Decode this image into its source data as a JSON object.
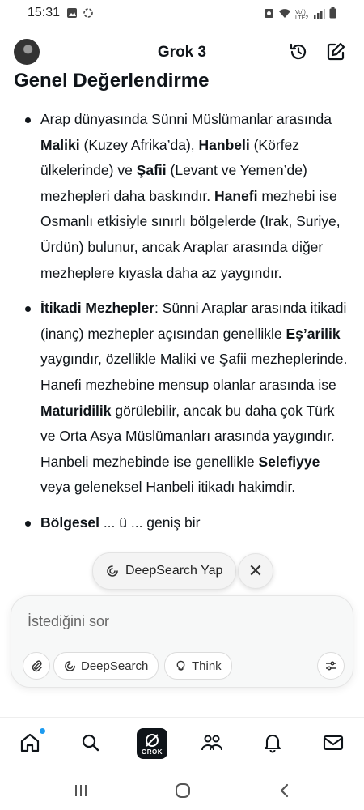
{
  "status_bar": {
    "time": "15:31",
    "left_icons": [
      "image-icon",
      "sync-icon"
    ],
    "right_icons": [
      "alarm-icon",
      "wifi-icon",
      "volte-icon",
      "signal-icon",
      "battery-icon"
    ],
    "network_label": "Vo))\nLTE2"
  },
  "header": {
    "title": "Grok 3",
    "avatar_icon": "avatar-icon",
    "history_icon": "history-icon",
    "edit_icon": "edit-icon"
  },
  "content": {
    "heading": "Genel Değerlendirme",
    "bullets": [
      {
        "segments": [
          {
            "text": "Arap dünyasında Sünni Müslümanlar arasında ",
            "bold": false
          },
          {
            "text": "Maliki",
            "bold": true
          },
          {
            "text": " (Kuzey Afrika’da), ",
            "bold": false
          },
          {
            "text": "Hanbeli",
            "bold": true
          },
          {
            "text": " (Körfez ülkelerinde) ve ",
            "bold": false
          },
          {
            "text": "Şafii",
            "bold": true
          },
          {
            "text": " (Levant ve Yemen’de) mezhepleri daha baskındır. ",
            "bold": false
          },
          {
            "text": "Hanefi",
            "bold": true
          },
          {
            "text": " mezhebi ise Osmanlı etkisiyle sınırlı bölgelerde (Irak, Suriye, Ürdün) bulunur, ancak Araplar arasında diğer mezheplere kıyasla daha az yaygındır.",
            "bold": false
          }
        ]
      },
      {
        "segments": [
          {
            "text": "İtikadi Mezhepler",
            "bold": true
          },
          {
            "text": ": Sünni Araplar arasında itikadi (inanç) mezhepler açısından genellikle ",
            "bold": false
          },
          {
            "text": "Eş’arilik",
            "bold": true
          },
          {
            "text": " yaygındır, özellikle Maliki ve Şafii mezheplerinde. Hanefi mezhebine mensup olanlar arasında ise ",
            "bold": false
          },
          {
            "text": "Maturidilik",
            "bold": true
          },
          {
            "text": " görülebilir, ancak bu daha çok Türk ve Orta Asya Müslümanları arasında yaygındır. Hanbeli mezhebinde ise genellikle ",
            "bold": false
          },
          {
            "text": "Selefiyye",
            "bold": true
          },
          {
            "text": " veya geleneksel Hanbeli itikadı hakimdir.",
            "bold": false
          }
        ]
      },
      {
        "segments": [
          {
            "text": "Bölgesel",
            "bold": true
          },
          {
            "text": " ... ü ... geniş bir",
            "bold": false
          }
        ]
      }
    ]
  },
  "deepsearch_suggestion": {
    "label": "DeepSearch Yap",
    "icon": "deepsearch-icon",
    "close_icon": "close-icon"
  },
  "composer": {
    "placeholder": "İstediğini sor",
    "attach_icon": "paperclip-icon",
    "deepsearch_label": "DeepSearch",
    "deepsearch_icon": "deepsearch-icon",
    "think_label": "Think",
    "think_icon": "lightbulb-icon",
    "settings_icon": "sliders-icon"
  },
  "bottom_nav": {
    "items": [
      "home-icon",
      "search-icon",
      "grok-icon",
      "people-icon",
      "bell-icon",
      "mail-icon"
    ],
    "grok_label": "GROK"
  },
  "android_nav": {
    "items": [
      "recents-icon",
      "home-circle-icon",
      "back-icon"
    ]
  }
}
